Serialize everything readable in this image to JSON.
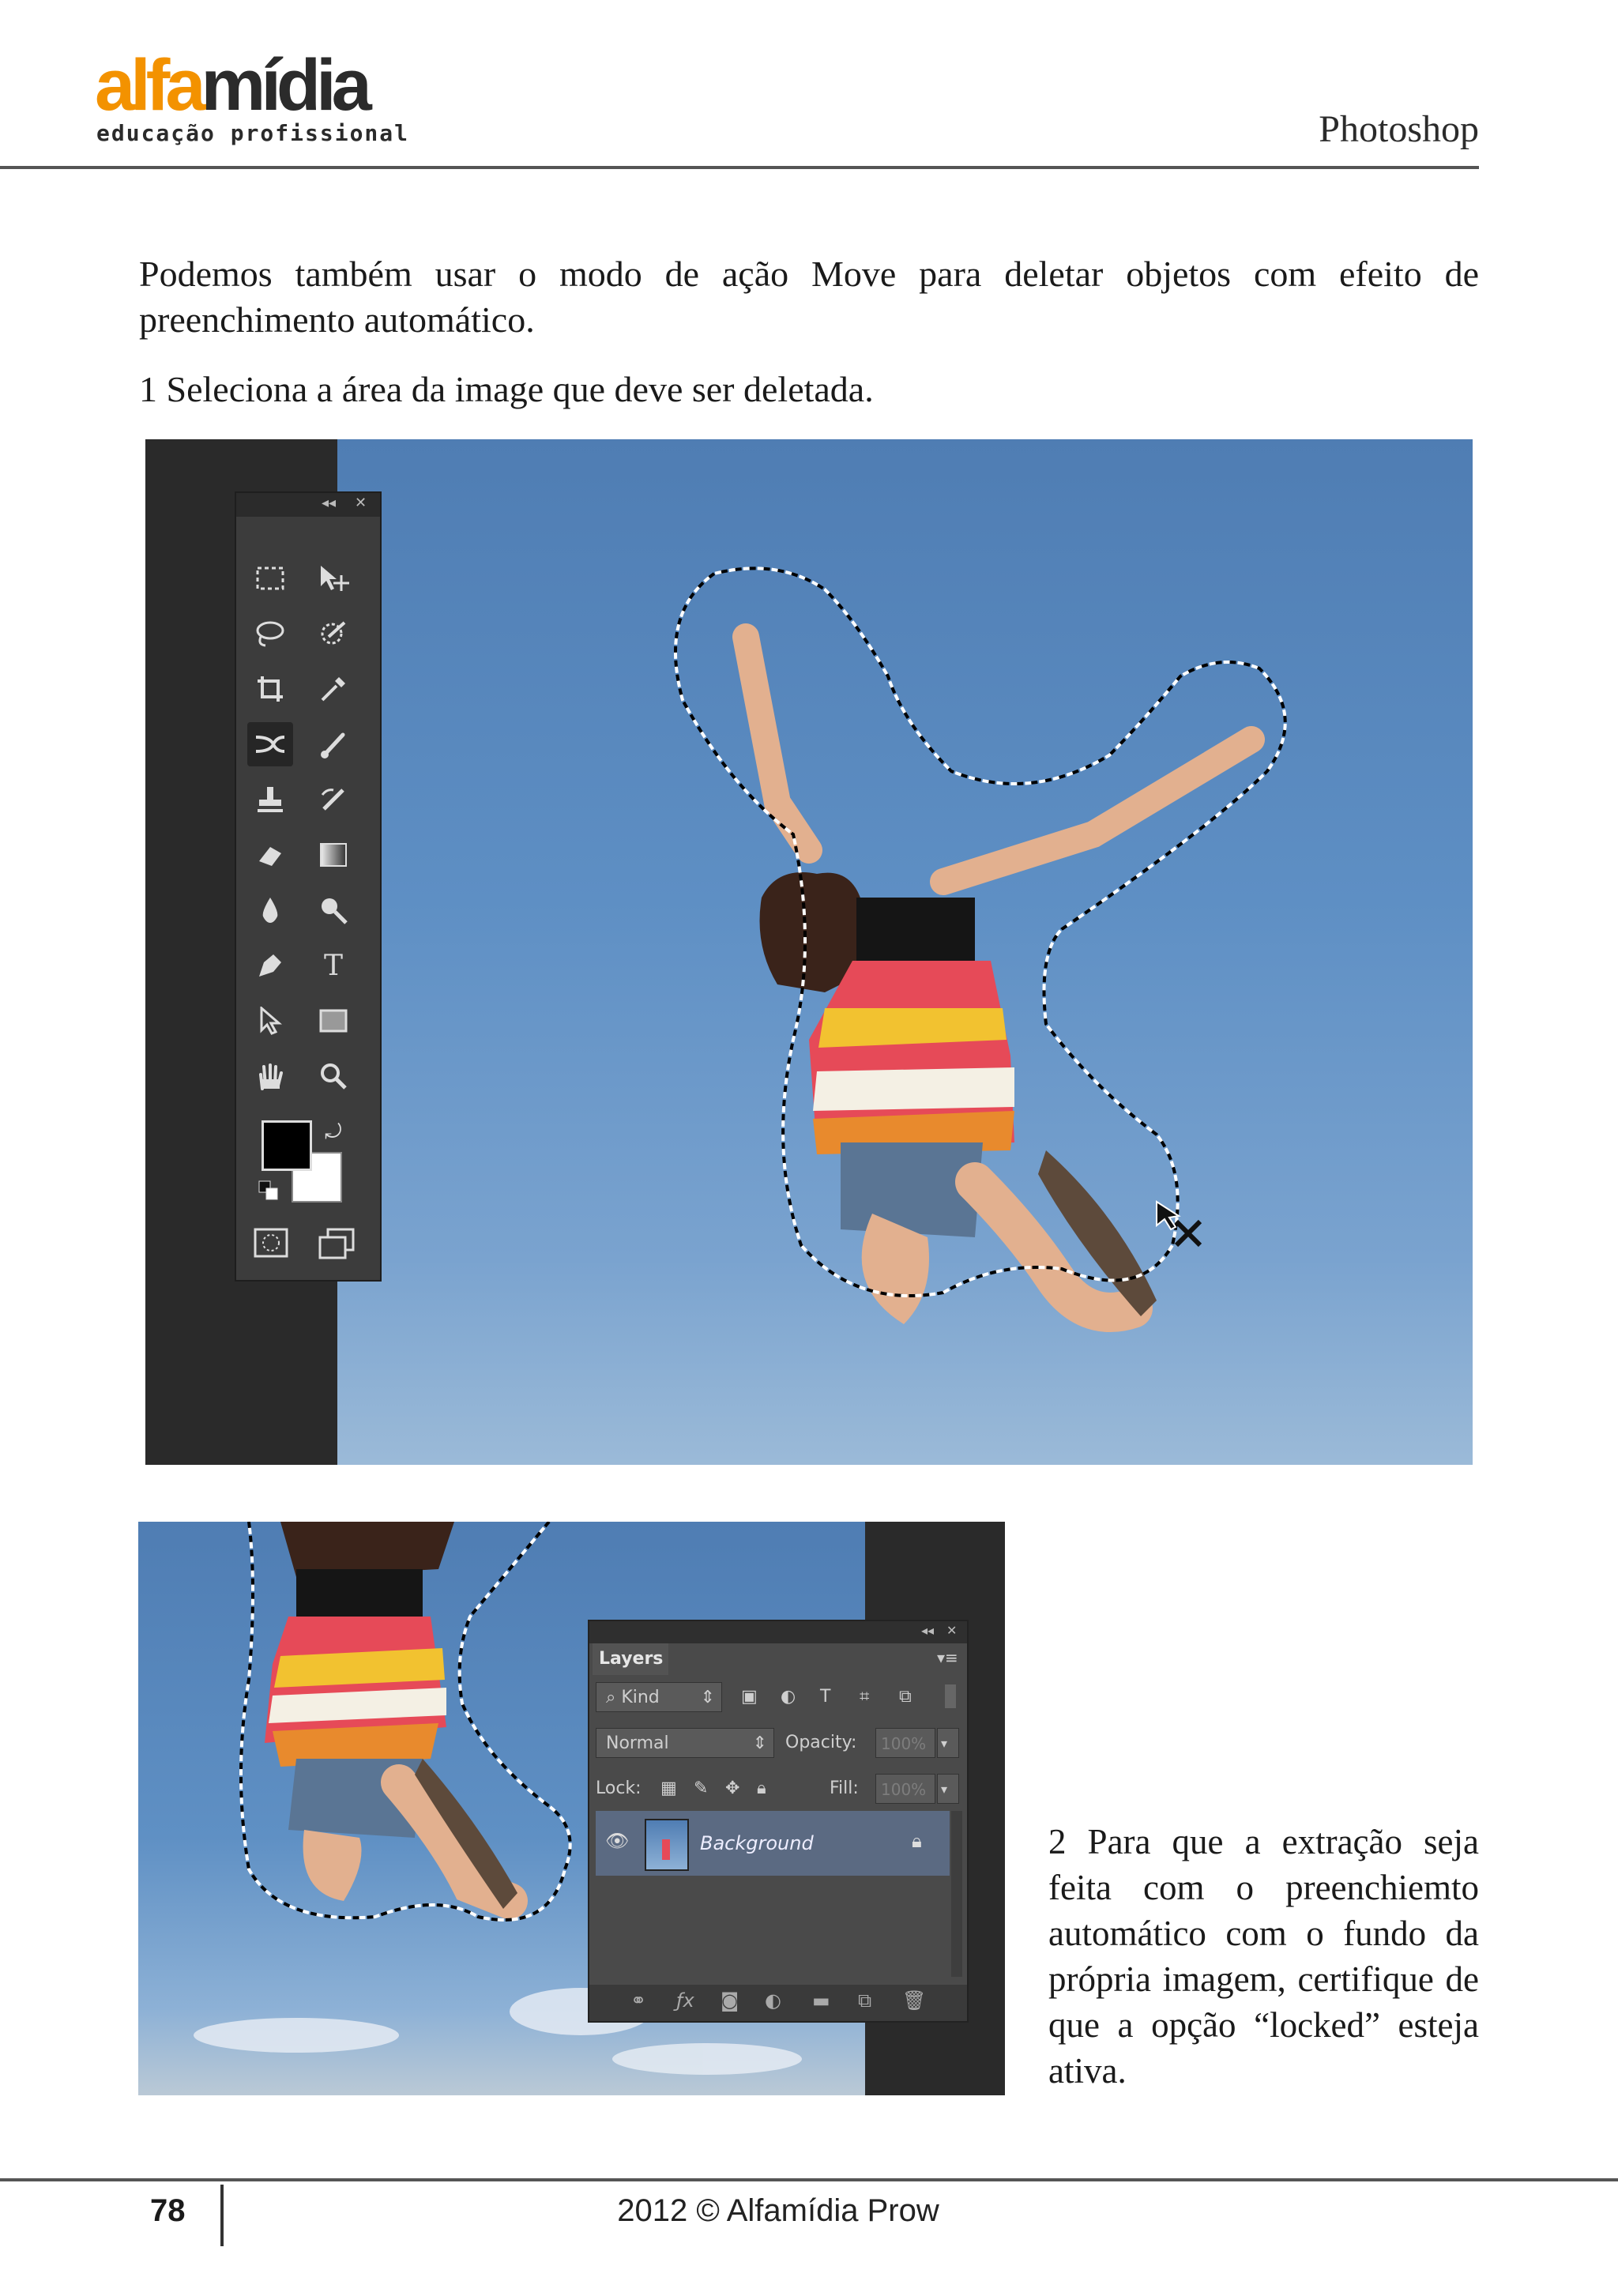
{
  "header": {
    "logo_part1": "alfa",
    "logo_part2": "mídia",
    "logo_tagline": "educação profissional",
    "title": "Photoshop"
  },
  "body": {
    "paragraph1": "Podemos também usar o modo de ação Move para deletar objetos com efeito de preenchimento automático.",
    "paragraph2": "1 Seleciona a área da image que deve ser deletada.",
    "paragraph3": "2 Para que a extração seja feita com o preenchiemto automático com o fundo da própria imagem, certifique de que a opção “locked” esteja ativa."
  },
  "layers_panel": {
    "tab_label": "Layers",
    "filter_kind": "Kind",
    "blend_mode": "Normal",
    "opacity_label": "Opacity:",
    "opacity_value": "100%",
    "lock_label": "Lock:",
    "fill_label": "Fill:",
    "fill_value": "100%",
    "layer_name": "Background"
  },
  "toolbox": {
    "icons": [
      "marquee-icon",
      "move-icon",
      "lasso-icon",
      "quick-selection-icon",
      "crop-icon",
      "eyedropper-icon",
      "content-aware-move-icon",
      "brush-icon",
      "clone-stamp-icon",
      "history-brush-icon",
      "eraser-icon",
      "gradient-icon",
      "blur-icon",
      "dodge-icon",
      "pen-icon",
      "type-icon",
      "path-selection-icon",
      "rectangle-icon",
      "hand-icon",
      "zoom-icon"
    ],
    "type_glyph": "T"
  },
  "footer": {
    "page_number": "78",
    "copyright": "2012 © Alfamídia Prow"
  }
}
